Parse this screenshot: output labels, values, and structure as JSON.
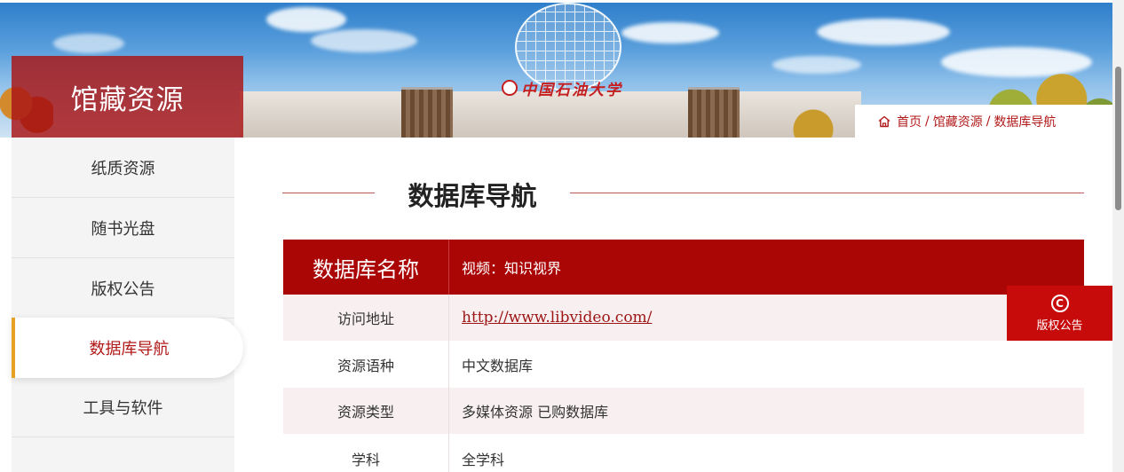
{
  "banner": {
    "section_title": "馆藏资源",
    "building_sign": "中国石油大学"
  },
  "breadcrumb": {
    "items": [
      "首页",
      "馆藏资源",
      "数据库导航"
    ],
    "separator": "/"
  },
  "sidebar": {
    "items": [
      {
        "label": "纸质资源",
        "active": false
      },
      {
        "label": "随书光盘",
        "active": false
      },
      {
        "label": "版权公告",
        "active": false
      },
      {
        "label": "数据库导航",
        "active": true
      },
      {
        "label": "工具与软件",
        "active": false
      }
    ]
  },
  "main": {
    "heading": "数据库导航",
    "table": {
      "header": {
        "label": "数据库名称",
        "value": "视频：知识视界"
      },
      "rows": [
        {
          "label": "访问地址",
          "value": "http://www.libvideo.com/",
          "is_link": true
        },
        {
          "label": "资源语种",
          "value": "中文数据库"
        },
        {
          "label": "资源类型",
          "value": "多媒体资源 已购数据库"
        },
        {
          "label": "学科",
          "value": "全学科"
        }
      ]
    }
  },
  "float_badge": {
    "icon": "copyright-icon",
    "icon_glyph": "C",
    "label": "版权公告"
  },
  "colors": {
    "brand_red": "#ab0606",
    "accent_gold": "#e6a024",
    "badge_red": "#c70a0a"
  }
}
